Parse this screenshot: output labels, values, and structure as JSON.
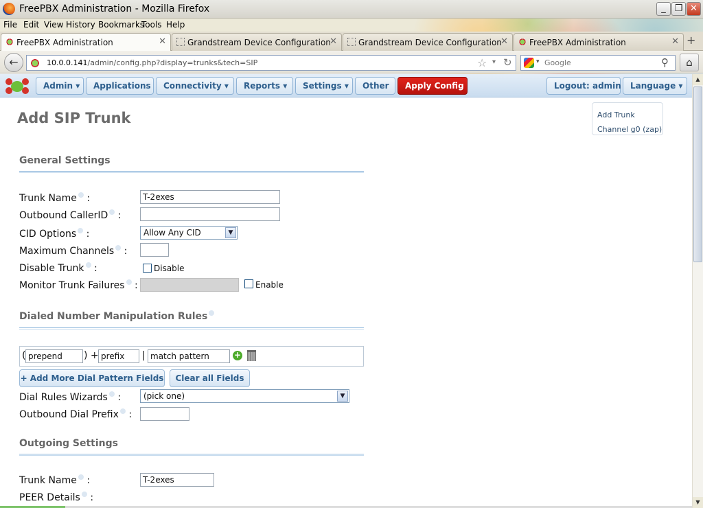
{
  "window": {
    "title": "FreePBX Administration - Mozilla Firefox"
  },
  "menu": [
    "File",
    "Edit",
    "View",
    "History",
    "Bookmarks",
    "Tools",
    "Help"
  ],
  "tabs": [
    {
      "label": "FreePBX Administration",
      "active": true
    },
    {
      "label": "Grandstream Device Configuration",
      "active": false
    },
    {
      "label": "Grandstream Device Configuration",
      "active": false
    },
    {
      "label": "FreePBX Administration",
      "active": false
    }
  ],
  "address": {
    "host": "10.0.0.141",
    "path": "/admin/config.php?display=trunks&tech=SIP"
  },
  "search": {
    "placeholder": "Google"
  },
  "pbxnav": {
    "admin": "Admin",
    "applications": "Applications",
    "connectivity": "Connectivity",
    "reports": "Reports",
    "settings": "Settings",
    "other": "Other",
    "apply": "Apply Config",
    "logout": "Logout: admin",
    "language": "Language"
  },
  "page": {
    "title": "Add SIP Trunk",
    "sidebar": [
      "Add Trunk",
      "Channel g0 (zap)"
    ]
  },
  "general": {
    "heading": "General Settings",
    "trunk_name_label": "Trunk Name",
    "trunk_name_value": "T-2exes",
    "outbound_cid_label": "Outbound CallerID",
    "outbound_cid_value": "",
    "cid_options_label": "CID Options",
    "cid_options_value": "Allow Any CID",
    "max_channels_label": "Maximum Channels",
    "max_channels_value": "",
    "disable_trunk_label": "Disable Trunk",
    "disable_checkbox_label": "Disable",
    "monitor_label": "Monitor Trunk Failures",
    "enable_checkbox_label": "Enable"
  },
  "dialrules": {
    "heading": "Dialed Number Manipulation Rules",
    "prepend_placeholder": "prepend",
    "prefix_placeholder": "prefix",
    "pattern_placeholder": "match pattern",
    "open_paren": "(",
    "close_plus": ") +",
    "pipe": "|",
    "add_more_label": "+ Add More Dial Pattern Fields",
    "clear_all_label": "Clear all Fields",
    "wizards_label": "Dial Rules Wizards",
    "wizards_value": "(pick one)",
    "outbound_prefix_label": "Outbound Dial Prefix",
    "outbound_prefix_value": ""
  },
  "outgoing": {
    "heading": "Outgoing Settings",
    "trunk_name_label": "Trunk Name",
    "trunk_name_value": "T-2exes",
    "peer_details_label": "PEER Details"
  }
}
